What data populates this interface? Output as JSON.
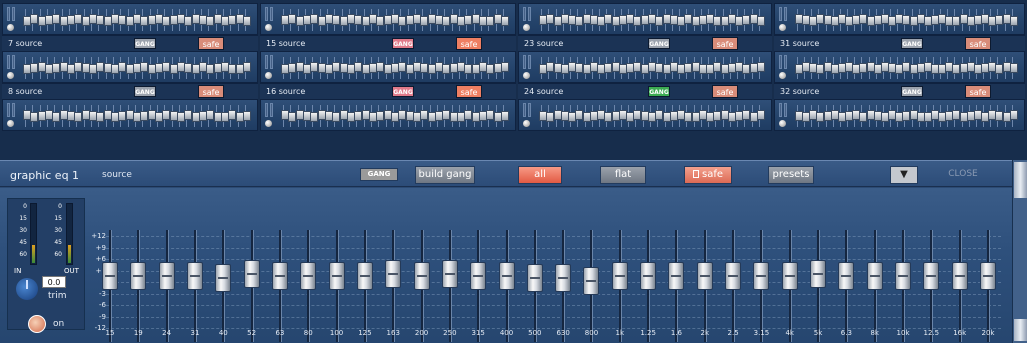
{
  "overview": {
    "rows": [
      {
        "type": "strip",
        "mini": [
          1,
          2,
          1,
          1,
          2,
          1,
          1,
          2,
          1,
          1,
          2,
          2,
          1,
          2,
          1,
          2,
          1,
          1,
          2,
          1,
          1,
          2,
          1,
          1,
          2,
          1,
          1,
          2,
          1,
          2,
          1
        ]
      },
      {
        "type": "label",
        "labels": [
          {
            "num": "7",
            "src": "source",
            "gang_color": "#9ba2ad",
            "safe_color": "#d98c79"
          },
          {
            "num": "15",
            "src": "source",
            "gang_color": "#e07a8a",
            "safe_color": "#ef7f62"
          },
          {
            "num": "23",
            "src": "source",
            "gang_color": "#9ba2ad",
            "safe_color": "#d98c79"
          },
          {
            "num": "31",
            "src": "source",
            "gang_color": "#9ba2ad",
            "safe_color": "#d98c79"
          }
        ]
      },
      {
        "type": "strip"
      },
      {
        "type": "label",
        "labels": [
          {
            "num": "8",
            "src": "source",
            "gang_color": "#9ba2ad",
            "safe_color": "#d98c79"
          },
          {
            "num": "16",
            "src": "source",
            "gang_color": "#e07a8a",
            "safe_color": "#ef7f62"
          },
          {
            "num": "24",
            "src": "source",
            "gang_color": "#3cab52",
            "safe_color": "#d98c79"
          },
          {
            "num": "32",
            "src": "source",
            "gang_color": "#9ba2ad",
            "safe_color": "#d98c79"
          }
        ]
      },
      {
        "type": "strip"
      }
    ],
    "gang_text": "GANG",
    "safe_text": "safe"
  },
  "eq": {
    "title": "graphic eq 1",
    "subtitle": "source",
    "buttons": {
      "gang": "GANG",
      "build_gang": "build gang",
      "all": "all",
      "flat": "flat",
      "safe": "safe",
      "presets": "presets",
      "dropdown": "▼",
      "close": "CLOSE"
    },
    "in_label": "IN",
    "out_label": "OUT",
    "vu_scale": [
      "0",
      "15",
      "30",
      "45",
      "60"
    ],
    "trim_value": "0.0",
    "trim_label": "trim",
    "on_label": "on",
    "db_scale": [
      "+12",
      "+9",
      "+6",
      "+3",
      "0",
      "-3",
      "-6",
      "-9",
      "-12"
    ],
    "bands": [
      {
        "freq": "15",
        "gain": 0
      },
      {
        "freq": "19",
        "gain": 0
      },
      {
        "freq": "24",
        "gain": 0
      },
      {
        "freq": "31",
        "gain": 0
      },
      {
        "freq": "40",
        "gain": -0.5
      },
      {
        "freq": "52",
        "gain": 0.5
      },
      {
        "freq": "63",
        "gain": 0
      },
      {
        "freq": "80",
        "gain": 0
      },
      {
        "freq": "100",
        "gain": 0
      },
      {
        "freq": "125",
        "gain": 0
      },
      {
        "freq": "163",
        "gain": 0.5
      },
      {
        "freq": "200",
        "gain": 0
      },
      {
        "freq": "250",
        "gain": 0.5
      },
      {
        "freq": "315",
        "gain": 0
      },
      {
        "freq": "400",
        "gain": 0
      },
      {
        "freq": "500",
        "gain": -0.5
      },
      {
        "freq": "630",
        "gain": -0.5
      },
      {
        "freq": "800",
        "gain": -1
      },
      {
        "freq": "1k",
        "gain": 0
      },
      {
        "freq": "1.25",
        "gain": 0
      },
      {
        "freq": "1.6",
        "gain": 0
      },
      {
        "freq": "2k",
        "gain": 0
      },
      {
        "freq": "2.5",
        "gain": 0
      },
      {
        "freq": "3.15",
        "gain": 0
      },
      {
        "freq": "4k",
        "gain": 0
      },
      {
        "freq": "5k",
        "gain": 0.5
      },
      {
        "freq": "6.3",
        "gain": 0
      },
      {
        "freq": "8k",
        "gain": 0
      },
      {
        "freq": "10k",
        "gain": 0
      },
      {
        "freq": "12.5",
        "gain": 0
      },
      {
        "freq": "16k",
        "gain": 0
      },
      {
        "freq": "20k",
        "gain": 0
      }
    ]
  }
}
